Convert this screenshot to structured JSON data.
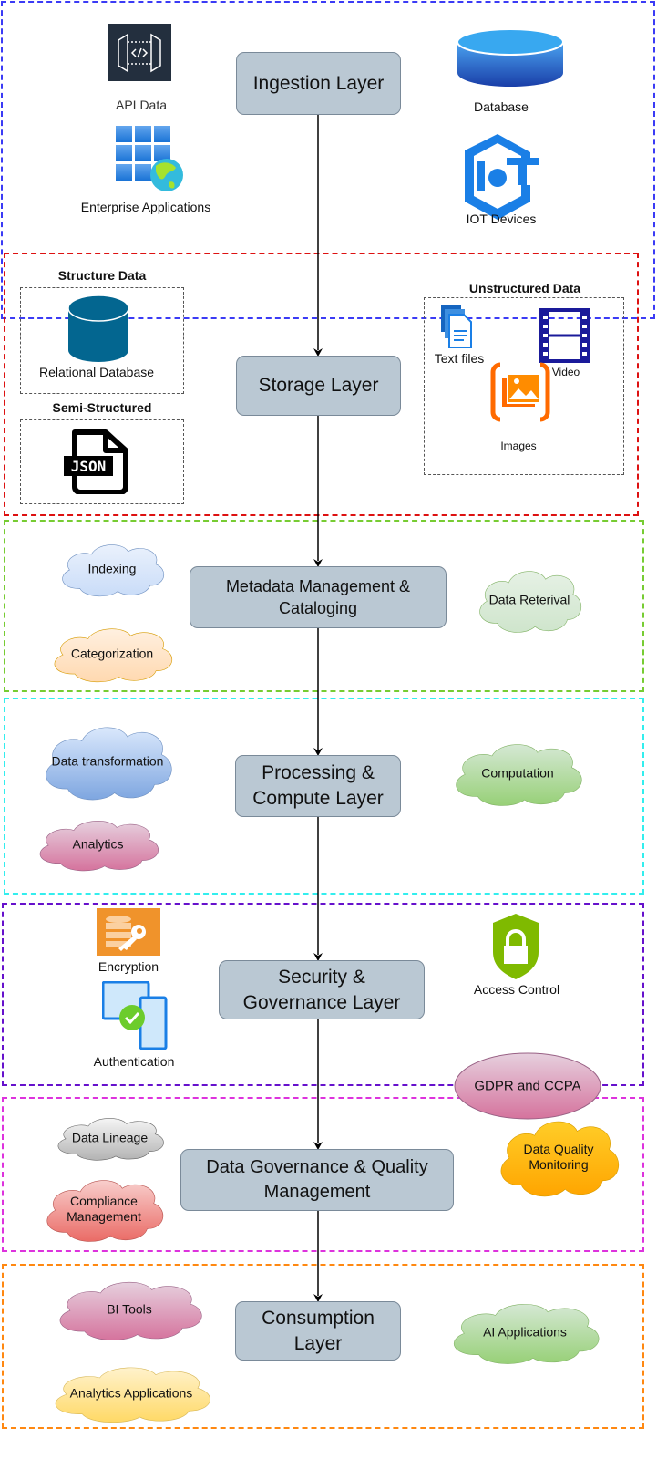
{
  "ingestion": {
    "title": "Ingestion Layer",
    "sources": [
      "API Data",
      "Enterprise Applications",
      "Database",
      "IOT Devices"
    ]
  },
  "storage": {
    "title": "Storage Layer",
    "structured_heading": "Structure Data",
    "structured_item": "Relational Database",
    "semi_heading": "Semi-Structured",
    "json_icon_text": "JSON",
    "unstructured_heading": "Unstructured Data",
    "unstructured_items": [
      "Text files",
      "Video",
      "Images"
    ]
  },
  "metadata": {
    "title": "Metadata Management & Cataloging",
    "clouds": [
      {
        "label": "Indexing",
        "fill": [
          "#eaf1fc",
          "#c9dcf8"
        ],
        "stroke": "#6c8ebf"
      },
      {
        "label": "Categorization",
        "fill": [
          "#fff0e0",
          "#ffd9b0"
        ],
        "stroke": "#d79b00"
      },
      {
        "label": "Data Reterival",
        "fill": [
          "#e6f1e5",
          "#cfe5cc"
        ],
        "stroke": "#82b366"
      }
    ]
  },
  "processing": {
    "title": "Processing & Compute Layer",
    "clouds": [
      {
        "label": "Data transformation",
        "fill": [
          "#dae8fc",
          "#7ea6e0"
        ],
        "stroke": "#6c8ebf"
      },
      {
        "label": "Analytics",
        "fill": [
          "#e6d0de",
          "#d5739d"
        ],
        "stroke": "#996185"
      },
      {
        "label": "Computation",
        "fill": [
          "#d5e8d4",
          "#97d077"
        ],
        "stroke": "#82b366"
      }
    ]
  },
  "security": {
    "title": "Security & Governance Layer",
    "items": [
      "Encryption",
      "Authentication",
      "Access Control"
    ],
    "ellipse": {
      "label": "GDPR and CCPA",
      "fill": [
        "#e6d0de",
        "#d5739d"
      ],
      "stroke": "#996185"
    }
  },
  "governance": {
    "title": "Data Governance & Quality Management",
    "clouds": [
      {
        "label": "Data Lineage",
        "fill": [
          "#f5f5f5",
          "#b3b3b3"
        ],
        "stroke": "#666666"
      },
      {
        "label": "Compliance Management",
        "fill": [
          "#f8cecc",
          "#ea6b66"
        ],
        "stroke": "#b85450"
      },
      {
        "label": "Data Quality Monitoring",
        "fill": [
          "#ffcd28",
          "#ffa500"
        ],
        "stroke": "#d79b00"
      }
    ]
  },
  "consumption": {
    "title": "Consumption Layer",
    "clouds": [
      {
        "label": "BI Tools",
        "fill": [
          "#e6d0de",
          "#d5739d"
        ],
        "stroke": "#996185"
      },
      {
        "label": "Analytics Applications",
        "fill": [
          "#fff2cc",
          "#ffd966"
        ],
        "stroke": "#d6b656"
      },
      {
        "label": "AI Applications",
        "fill": [
          "#d5e8d4",
          "#97d077"
        ],
        "stroke": "#82b366"
      }
    ]
  },
  "section_colors": {
    "ingestion": "#3b3bf5",
    "storage": "#dd1111",
    "metadata": "#77cc33",
    "processing": "#33eeee",
    "security": "#6611cc",
    "governance": "#dd33dd",
    "consumption": "#ff8811"
  }
}
